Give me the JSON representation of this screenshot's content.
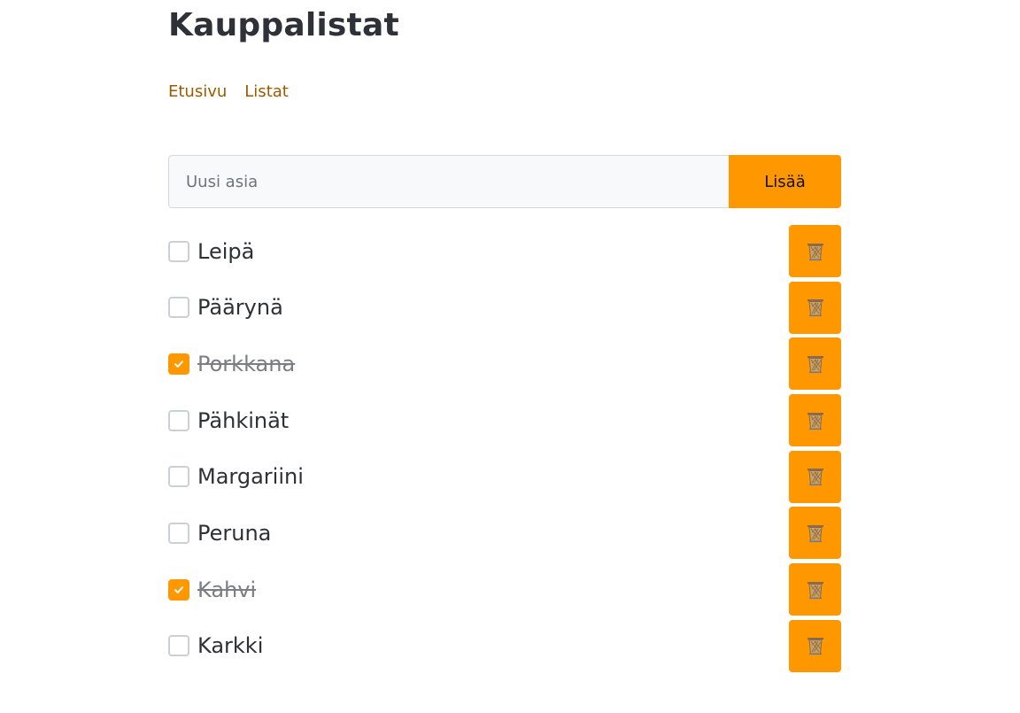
{
  "header": {
    "title": "Kauppalistat"
  },
  "nav": {
    "links": [
      {
        "label": "Etusivu"
      },
      {
        "label": "Listat"
      }
    ]
  },
  "add_form": {
    "placeholder": "Uusi asia",
    "value": "",
    "button_label": "Lisää"
  },
  "items": [
    {
      "label": "Leipä",
      "checked": false,
      "delete_icon": "trash-basket-icon"
    },
    {
      "label": "Päärynä",
      "checked": false,
      "delete_icon": "trash-basket-icon"
    },
    {
      "label": "Porkkana",
      "checked": true,
      "delete_icon": "trash-basket-icon"
    },
    {
      "label": "Pähkinät",
      "checked": false,
      "delete_icon": "trash-basket-icon"
    },
    {
      "label": "Margariini",
      "checked": false,
      "delete_icon": "trash-basket-icon"
    },
    {
      "label": "Peruna",
      "checked": false,
      "delete_icon": "trash-basket-icon"
    },
    {
      "label": "Kahvi",
      "checked": true,
      "delete_icon": "trash-basket-icon"
    },
    {
      "label": "Karkki",
      "checked": false,
      "delete_icon": "trash-basket-icon"
    }
  ],
  "colors": {
    "accent": "#ff9800",
    "link": "#9a5b00",
    "text": "#2d3136",
    "done_text": "#7b7f85"
  }
}
